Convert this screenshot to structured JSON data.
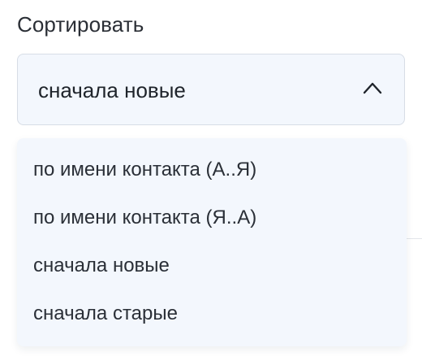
{
  "sort": {
    "label": "Сортировать",
    "selected": "сначала новые",
    "chevron_icon": "chevron-up-icon",
    "options": [
      "по имени контакта (А..Я)",
      "по имени контакта (Я..А)",
      "сначала новые",
      "сначала старые"
    ]
  },
  "colors": {
    "field_background": "#f3f7fd",
    "field_border": "#d7dde6",
    "text": "#2a2f37"
  }
}
